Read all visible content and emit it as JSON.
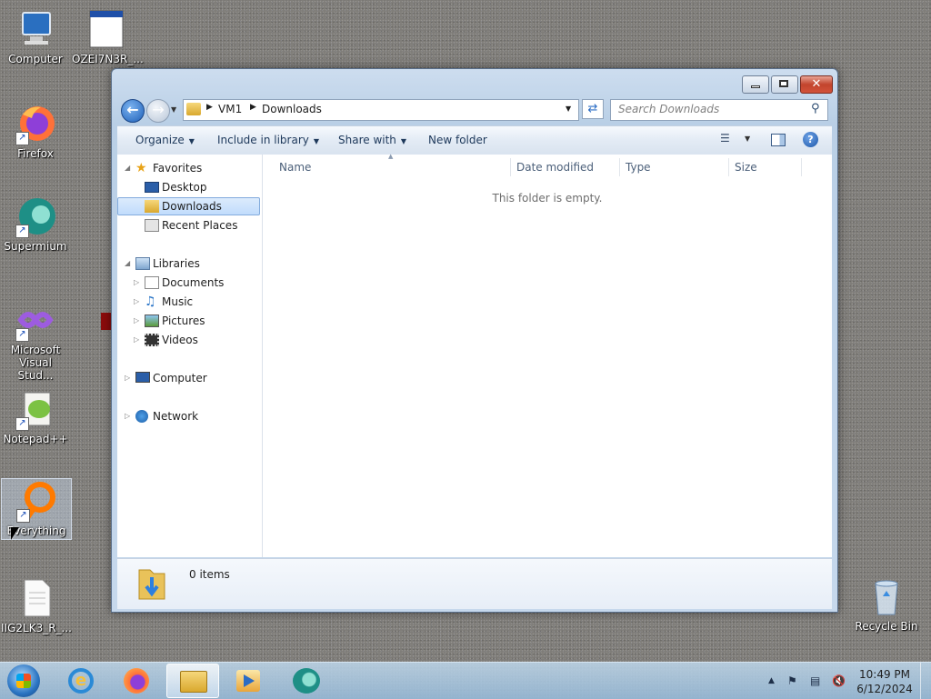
{
  "desktop": {
    "icons": [
      {
        "label": "Computer"
      },
      {
        "label": "OZEI7N3R_..."
      },
      {
        "label": "Firefox"
      },
      {
        "label": "Supermium"
      },
      {
        "label": "Microsoft Visual Stud..."
      },
      {
        "label": "Notepad++"
      },
      {
        "label": "Everything"
      },
      {
        "label": "IIG2LK3_R_..."
      },
      {
        "label": "Recycle Bin"
      }
    ]
  },
  "window": {
    "breadcrumb": [
      "VM1",
      "Downloads"
    ],
    "search_placeholder": "Search Downloads",
    "toolbar": {
      "organize": "Organize",
      "include_in_library": "Include in library",
      "share_with": "Share with",
      "new_folder": "New folder"
    },
    "nav": {
      "favorites": "Favorites",
      "desktop": "Desktop",
      "downloads": "Downloads",
      "recent_places": "Recent Places",
      "libraries": "Libraries",
      "documents": "Documents",
      "music": "Music",
      "pictures": "Pictures",
      "videos": "Videos",
      "computer": "Computer",
      "network": "Network"
    },
    "columns": {
      "name": "Name",
      "date_modified": "Date modified",
      "type": "Type",
      "size": "Size"
    },
    "empty_message": "This folder is empty.",
    "status": "0 items"
  },
  "taskbar": {
    "time": "10:49 PM",
    "date": "6/12/2024"
  },
  "colors": {
    "accent": "#1e395b",
    "selection": "#c1dcfc"
  }
}
